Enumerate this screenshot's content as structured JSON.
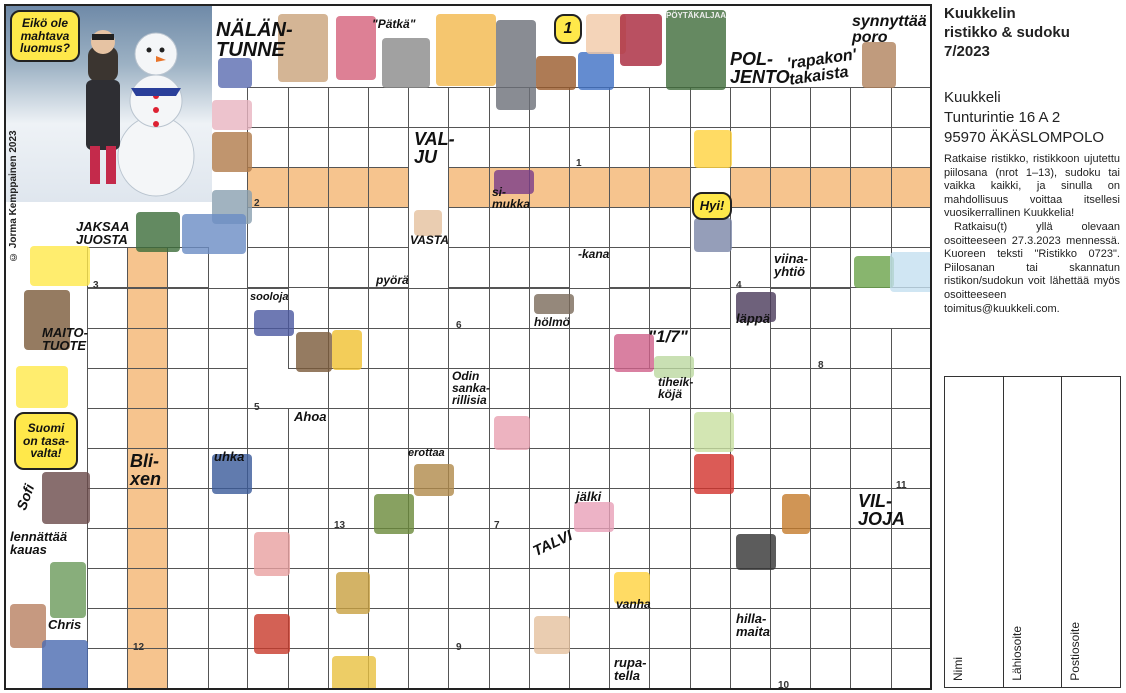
{
  "sidebar": {
    "title_lines": [
      "Kuukkelin",
      "ristikko & sudoku",
      "7/2023"
    ],
    "address_lines": [
      "Kuukkeli",
      "Tunturintie 16 A 2",
      "95970 ÄKÄSLOMPOLO"
    ],
    "instructions_p1": "Ratkaise ristikko, ristikkoon ujutettu piilosana (nrot 1–13), sudoku tai vaikka kaikki, ja sinulla on mahdollisuus voittaa itsellesi vuosikerrallinen Kuukkelia!",
    "instructions_p2": "Ratkaisu(t) yllä olevaan osoitteeseen 27.3.2023 mennessä. Kuoreen teksti \"Ristikko 0723\". Piilosanan tai skannatun ristikon/sudokun voit lähettää myös osoitteeseen toimitus@kuukkeli.com.",
    "form_fields": [
      "Nimi",
      "Lähiosoite",
      "Postiosoite"
    ]
  },
  "puzzle": {
    "credit": "© Jorma Kemppainen 2023",
    "bubbles": [
      {
        "id": "eiko",
        "text": "Eikö ole\nmahtava\nluomus?"
      },
      {
        "id": "suomi",
        "text": "Suomi\non tasa-\nvalta!"
      },
      {
        "id": "hyi",
        "text": "Hyi!"
      },
      {
        "id": "one",
        "text": "1"
      }
    ],
    "clues": [
      {
        "id": "nalantunne",
        "text": "NÄLÄN-\nTUNNE"
      },
      {
        "id": "patka",
        "text": "\"Pätkä\""
      },
      {
        "id": "poytakaljaa",
        "text": "PÖYTÄKALJAA"
      },
      {
        "id": "synnyttaa",
        "text": "synnyttää\nporo"
      },
      {
        "id": "polento",
        "text": "POL-\nJENTO"
      },
      {
        "id": "rapakon",
        "text": "'rapakon'\ntakaista"
      },
      {
        "id": "valju",
        "text": "VAL-\nJU"
      },
      {
        "id": "simukka",
        "text": "si-\nmukka"
      },
      {
        "id": "jaksaa",
        "text": "JAKSAA\nJUOSTA"
      },
      {
        "id": "vasta",
        "text": "VASTA"
      },
      {
        "id": "kana",
        "text": "-kana"
      },
      {
        "id": "viina",
        "text": "viina-\nyhtiö"
      },
      {
        "id": "pyora",
        "text": "pyörä"
      },
      {
        "id": "sooloja",
        "text": "sooloja"
      },
      {
        "id": "holmo",
        "text": "hölmö"
      },
      {
        "id": "lappa",
        "text": "läppä"
      },
      {
        "id": "maito",
        "text": "MAITO-\nTUOTE"
      },
      {
        "id": "seiska",
        "text": "\"1/7\""
      },
      {
        "id": "tiheik",
        "text": "tiheik-\nköjä"
      },
      {
        "id": "odin",
        "text": "Odin\nsanka-\nrillisia"
      },
      {
        "id": "ahoa",
        "text": "Ahoa"
      },
      {
        "id": "blixen",
        "text": "Bli-\nxen"
      },
      {
        "id": "uhka",
        "text": "uhka"
      },
      {
        "id": "erottaa",
        "text": "erottaa"
      },
      {
        "id": "sofi",
        "text": "Sofi"
      },
      {
        "id": "jalki",
        "text": "jälki"
      },
      {
        "id": "viljoja",
        "text": "VIL-\nJOJA"
      },
      {
        "id": "lennattaa",
        "text": "lennättää\nkauas"
      },
      {
        "id": "talvi",
        "text": "TALVI"
      },
      {
        "id": "vanha",
        "text": "vanha"
      },
      {
        "id": "chris",
        "text": "Chris"
      },
      {
        "id": "hillamaita",
        "text": "hilla-\nmaita"
      },
      {
        "id": "rupatella",
        "text": "rupa-\ntella"
      }
    ],
    "cell_numbers": [
      "1",
      "2",
      "3",
      "4",
      "5",
      "6",
      "7",
      "8",
      "9",
      "10",
      "11",
      "12",
      "13"
    ],
    "colors": {
      "highlight": "#f6c48e",
      "bubble": "#ffe84a",
      "grid_line": "#555555"
    }
  }
}
